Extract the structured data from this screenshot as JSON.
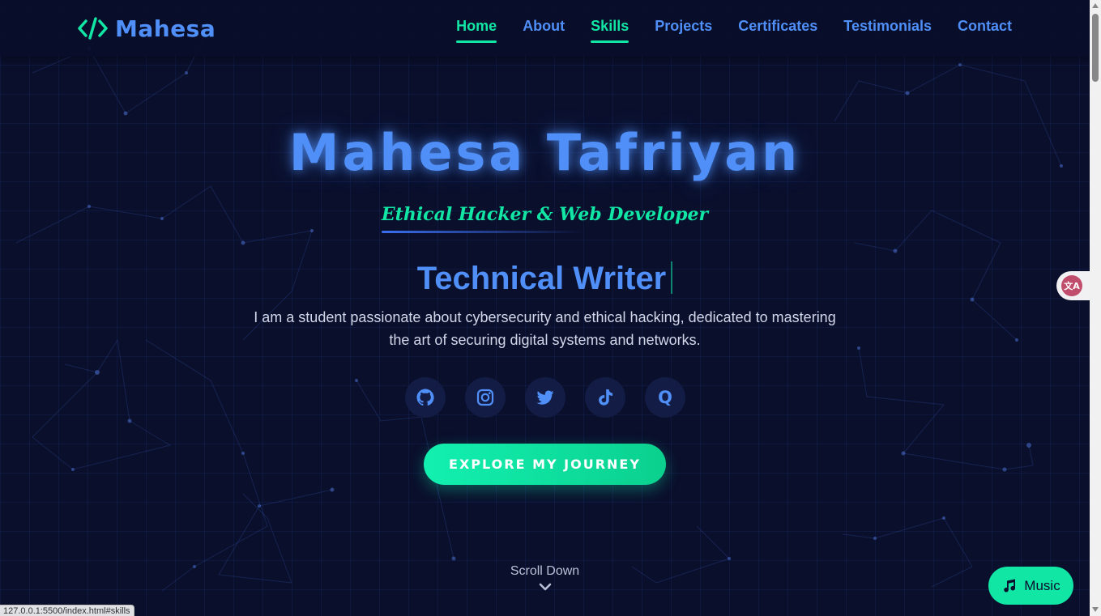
{
  "header": {
    "logo_symbol": "</>",
    "logo_text": "Mahesa",
    "nav": [
      {
        "label": "Home",
        "active": true
      },
      {
        "label": "About",
        "active": false
      },
      {
        "label": "Skills",
        "active": true
      },
      {
        "label": "Projects",
        "active": false
      },
      {
        "label": "Certificates",
        "active": false
      },
      {
        "label": "Testimonials",
        "active": false
      },
      {
        "label": "Contact",
        "active": false
      }
    ]
  },
  "hero": {
    "name": "Mahesa Tafriyan",
    "subtitle": "Ethical Hacker & Web Developer",
    "typing_text": "Technical Writer",
    "bio": "I am a student passionate about cybersecurity and ethical hacking, dedicated to mastering the art of securing digital systems and networks.",
    "socials": [
      {
        "icon": "github-icon"
      },
      {
        "icon": "instagram-icon"
      },
      {
        "icon": "twitter-icon"
      },
      {
        "icon": "tiktok-icon"
      },
      {
        "icon": "quora-icon",
        "glyph": "Q"
      }
    ],
    "cta_label": "EXPLORE MY JOURNEY",
    "scroll_label": "Scroll Down"
  },
  "widgets": {
    "translate_glyph": "文A",
    "music_label": "Music"
  },
  "browser": {
    "status_url": "127.0.0.1:5500/index.html#skills"
  },
  "colors": {
    "background": "#0a0f2c",
    "primary_blue": "#4f8ff7",
    "accent_green": "#12e6a5",
    "text_light": "#d2d8ea"
  }
}
